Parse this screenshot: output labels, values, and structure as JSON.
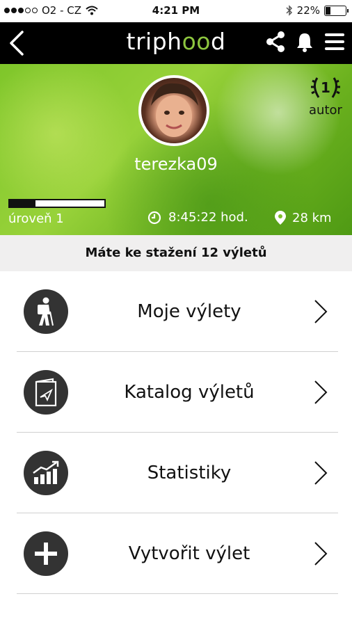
{
  "status_bar": {
    "carrier": "O2 - CZ",
    "time": "4:21 PM",
    "battery": "22%",
    "battery_level": 0.22,
    "signal_dots_filled": 3,
    "signal_dots_total": 5
  },
  "nav": {
    "logo_prefix": "triph",
    "logo_oo": "oo",
    "logo_suffix": "d",
    "icons": [
      "back-arrow-icon",
      "share-icon",
      "bell-icon",
      "hamburger-icon"
    ]
  },
  "profile": {
    "username": "terezka09",
    "rank_number": "1",
    "rank_label": "autor",
    "level": "úroveň 1",
    "level_progress": 0.27,
    "time": "8:45:22 hod.",
    "distance": "28 km"
  },
  "banner": {
    "text": "Máte ke stažení 12 výletů"
  },
  "menu": [
    {
      "label": "Moje výlety",
      "icon": "hiker-icon"
    },
    {
      "label": "Katalog výletů",
      "icon": "catalog-icon"
    },
    {
      "label": "Statistiky",
      "icon": "statistics-icon"
    },
    {
      "label": "Vytvořit výlet",
      "icon": "plus-icon"
    }
  ],
  "colors": {
    "nav_bg": "#000000",
    "accent_green": "#8dc63f",
    "icon_circle": "#333333",
    "banner_bg": "#f0efef"
  }
}
